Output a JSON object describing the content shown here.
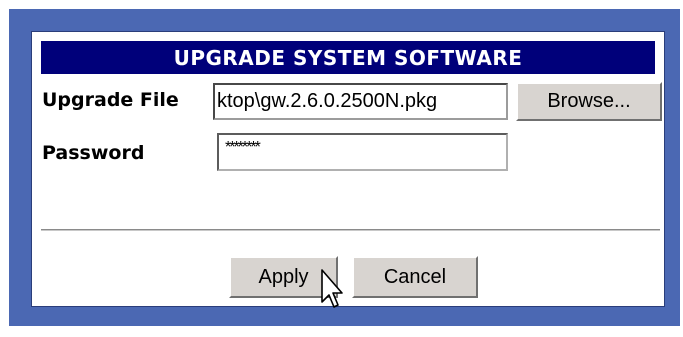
{
  "title": "UPGRADE SYSTEM SOFTWARE",
  "upgrade_file": {
    "label": "Upgrade File",
    "value": "ktop\\gw.2.6.0.2500N.pkg",
    "browse_label": "Browse..."
  },
  "password": {
    "label": "Password",
    "value": "********"
  },
  "actions": {
    "apply_label": "Apply",
    "cancel_label": "Cancel"
  },
  "colors": {
    "frame": "#4b68b3",
    "title_bar": "#00007a",
    "button": "#d8d4d0"
  },
  "icons": {
    "cursor": "arrow-cursor-icon"
  }
}
